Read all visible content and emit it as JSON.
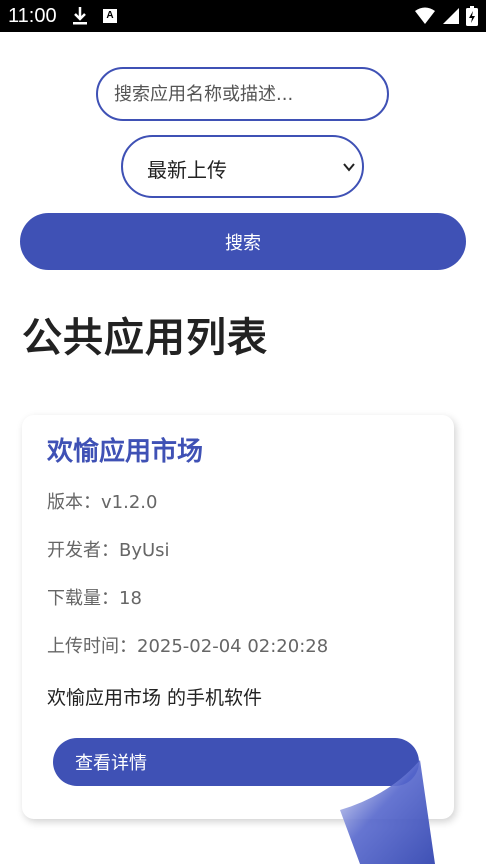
{
  "status_bar": {
    "time": "11:00",
    "notification_icons": [
      "download-icon",
      "a-badge-icon"
    ],
    "system_icons": [
      "wifi-icon",
      "signal-icon",
      "battery-icon"
    ]
  },
  "search": {
    "placeholder": "搜索应用名称或描述...",
    "value": ""
  },
  "sort": {
    "selected": "最新上传"
  },
  "search_button": {
    "label": "搜索"
  },
  "page_title": "公共应用列表",
  "apps": [
    {
      "name": "欢愉应用市场",
      "version": "版本：v1.2.0",
      "developer": "开发者：ByUsi",
      "downloads": "下载量：18",
      "upload_time": "上传时间：2025-02-04 02:20:28",
      "description": "欢愉应用市场 的手机软件",
      "detail_label": "查看详情"
    }
  ],
  "colors": {
    "accent": "#3f51b5",
    "status_bar": "#000000",
    "background": "#ffffff"
  }
}
